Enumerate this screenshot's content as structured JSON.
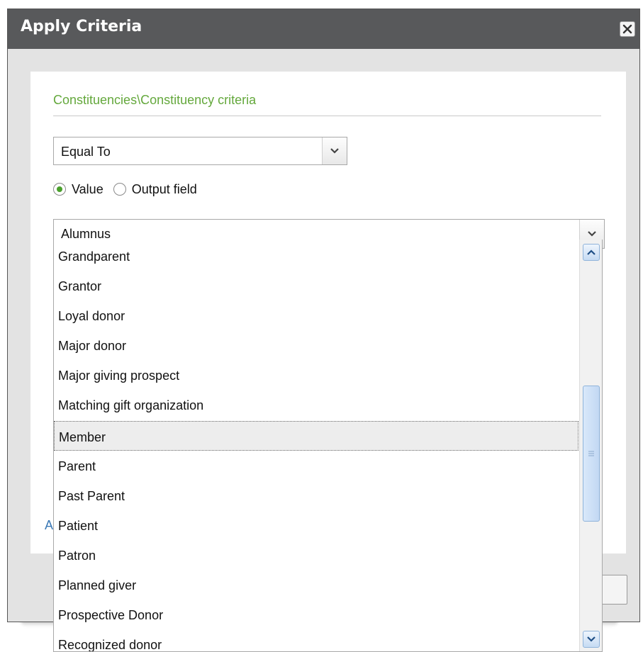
{
  "dialog": {
    "title": "Apply Criteria",
    "section_title": "Constituencies\\Constituency criteria",
    "partial_link_text": "A"
  },
  "operator_select": {
    "value": "Equal To"
  },
  "radio_group": {
    "options": [
      {
        "label": "Value",
        "selected": true
      },
      {
        "label": "Output field",
        "selected": false
      }
    ]
  },
  "value_select": {
    "value": "Alumnus",
    "options": [
      "Grandparent",
      "Grantor",
      "Loyal donor",
      "Major donor",
      "Major giving prospect",
      "Matching gift organization",
      "Member",
      "Parent",
      "Past Parent",
      "Patient",
      "Patron",
      "Planned giver",
      "Prospective Donor",
      "Recognized donor"
    ],
    "highlighted": "Member"
  },
  "colors": {
    "titlebar": "#58595b",
    "section_title": "#64a83c",
    "radio_selected": "#4aa02c",
    "scrollbar_accent": "#8fb3da"
  }
}
